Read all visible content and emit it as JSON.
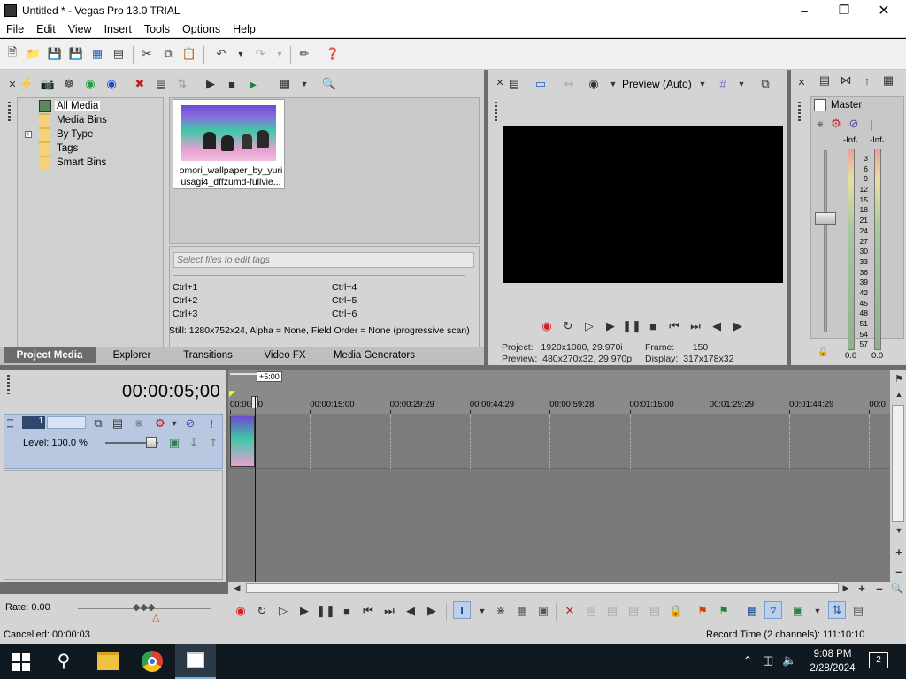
{
  "window": {
    "title": "Untitled * - Vegas Pro 13.0 TRIAL"
  },
  "menu": [
    "File",
    "Edit",
    "View",
    "Insert",
    "Tools",
    "Options",
    "Help"
  ],
  "project_media": {
    "tree": [
      "All Media",
      "Media Bins",
      "By Type",
      "Tags",
      "Smart Bins"
    ],
    "selected_tree": "All Media",
    "media_item_name_line1": "omori_wallpaper_by_yuri",
    "media_item_name_line2": "usagi4_dffzumd-fullvie...",
    "tags_placeholder": "Select files to edit tags",
    "shortcuts": [
      "Ctrl+1",
      "Ctrl+4",
      "Ctrl+2",
      "Ctrl+5",
      "Ctrl+3",
      "Ctrl+6"
    ],
    "still_info": "Still: 1280x752x24, Alpha = None, Field Order = None (progressive scan)"
  },
  "dock_tabs": [
    "Project Media",
    "Explorer",
    "Transitions",
    "Video FX",
    "Media Generators"
  ],
  "active_tab": "Project Media",
  "preview": {
    "mode": "Preview (Auto)",
    "project_label": "Project:",
    "project_value": "1920x1080, 29.970i",
    "preview_label": "Preview:",
    "preview_value": "480x270x32, 29.970p",
    "frame_label": "Frame:",
    "frame_value": "150",
    "display_label": "Display:",
    "display_value": "317x178x32"
  },
  "master": {
    "label": "Master",
    "left_peak": "-Inf.",
    "right_peak": "-Inf.",
    "scale": [
      "3",
      "6",
      "9",
      "12",
      "15",
      "18",
      "21",
      "24",
      "27",
      "30",
      "33",
      "36",
      "39",
      "42",
      "45",
      "48",
      "51",
      "54",
      "57"
    ],
    "left_value": "0.0",
    "right_value": "0.0"
  },
  "timeline": {
    "timecode": "00:00:05;00",
    "offset_badge": "+5:00",
    "ruler": [
      "00:00:00",
      "00:00:15:00",
      "00:00:29:29",
      "00:00:44:29",
      "00:00:59:28",
      "00:01:15:00",
      "00:01:29:29",
      "00:01:44:29",
      "00:0"
    ],
    "track_number": "1",
    "track_level": "Level: 100.0 %",
    "rate": "Rate: 0.00"
  },
  "status": {
    "left": "Cancelled: 00:00:03",
    "right": "Record Time (2 channels): 111:10:10"
  },
  "taskbar": {
    "time": "9:08 PM",
    "date": "2/28/2024",
    "notifications": "2"
  },
  "colors": {
    "workspace": "#6c6c6c",
    "panel": "#d4d4d4",
    "track_header": "#b8c8e0",
    "taskbar": "#101820",
    "record": "#d22020"
  }
}
